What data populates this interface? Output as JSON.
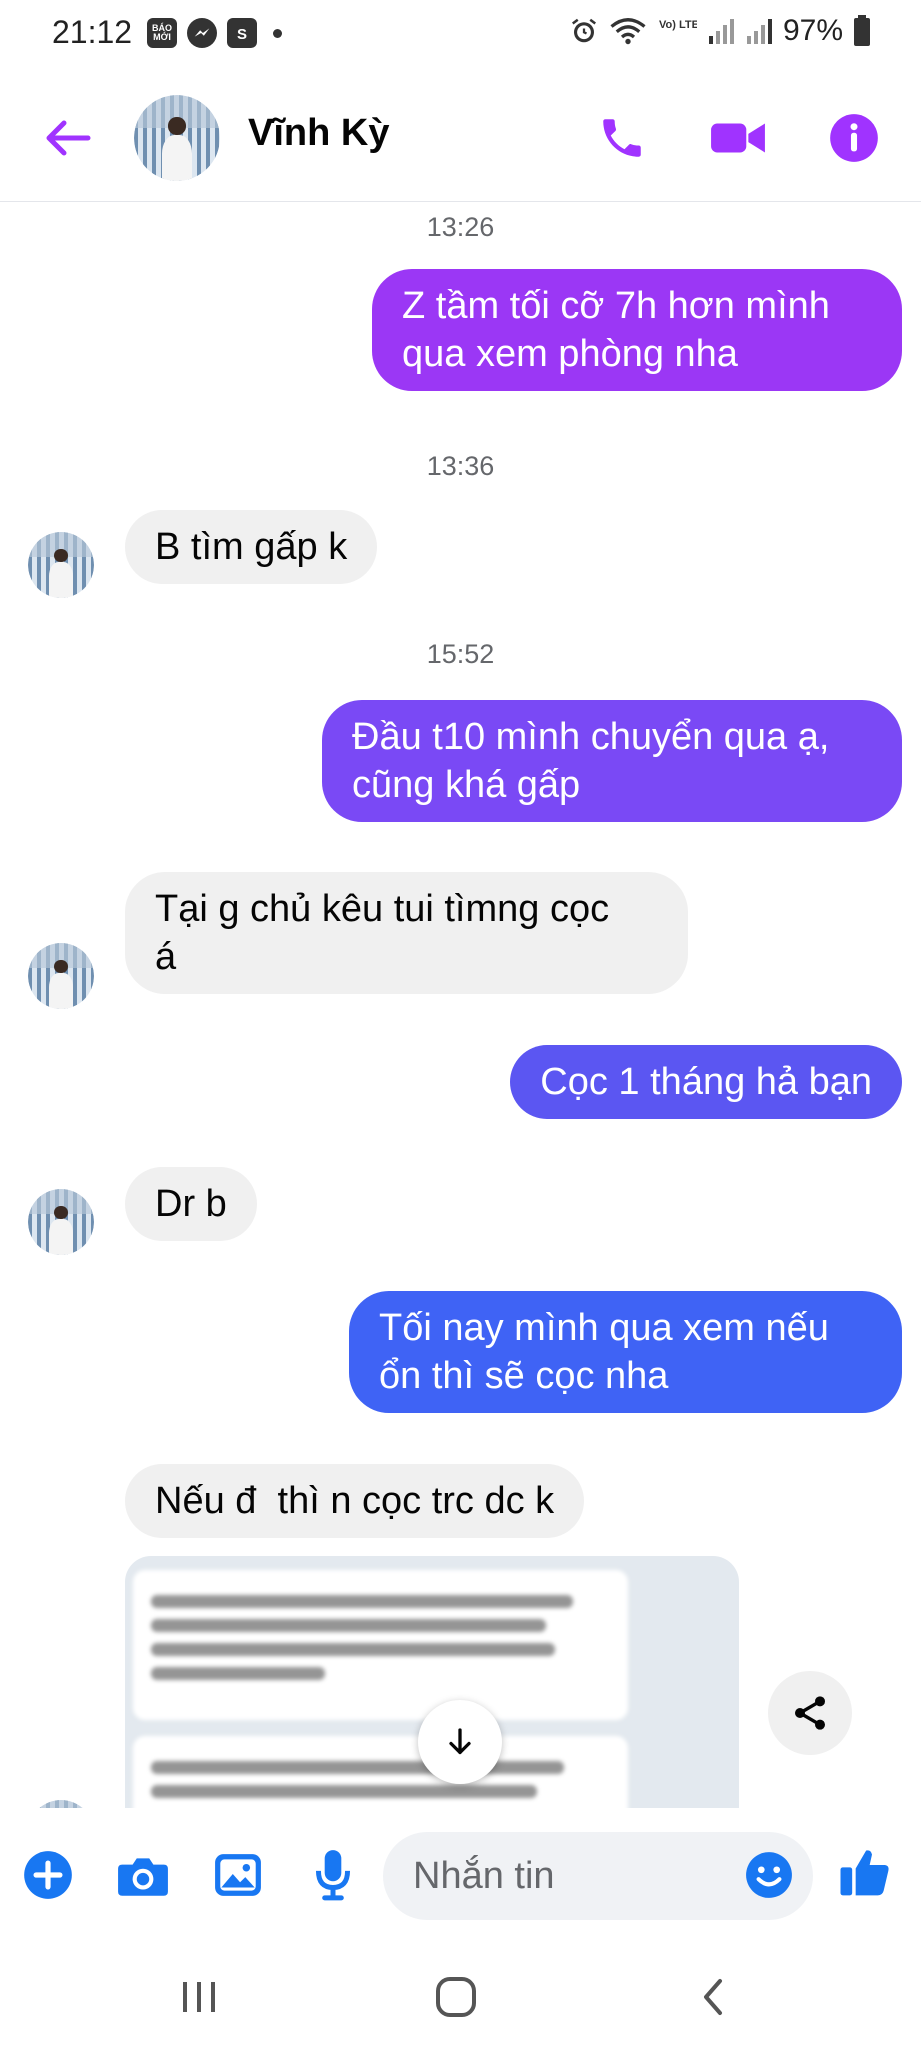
{
  "status_bar": {
    "time": "21:12",
    "app_badge_label": "BÁO MỚI",
    "battery_text": "97%",
    "network_label": "Vo) LTE1"
  },
  "header": {
    "contact_name": "Vĩnh Kỳ",
    "accent_color": "#a033ff"
  },
  "messages": [
    {
      "kind": "timestamp",
      "text": "13:26"
    },
    {
      "kind": "outgoing",
      "color": "#9b37f5",
      "text": "Z tầm tối cỡ 7h hơn mình\nqua xem phòng nha"
    },
    {
      "kind": "timestamp",
      "text": "13:36"
    },
    {
      "kind": "incoming",
      "text": "B tìm gấp k"
    },
    {
      "kind": "timestamp",
      "text": "15:52"
    },
    {
      "kind": "outgoing",
      "color": "#7a49f5",
      "text": "Đầu t10 mình chuyển qua ạ,\ncũng khá gấp"
    },
    {
      "kind": "incoming",
      "text": "Tại g chủ kêu tui tìmng cọc\ná"
    },
    {
      "kind": "outgoing",
      "color": "#5b56f2",
      "text": "Cọc 1 tháng hả bạn"
    },
    {
      "kind": "incoming",
      "text": "Dr b"
    },
    {
      "kind": "outgoing",
      "color": "#3f63f5",
      "text": "Tối nay mình qua xem nếu\nổn thì sẽ cọc nha"
    },
    {
      "kind": "incoming",
      "text": "Nếu đ  thì n cọc trc dc k"
    }
  ],
  "composer": {
    "placeholder": "Nhắn tin",
    "icon_color": "#1877f2"
  }
}
